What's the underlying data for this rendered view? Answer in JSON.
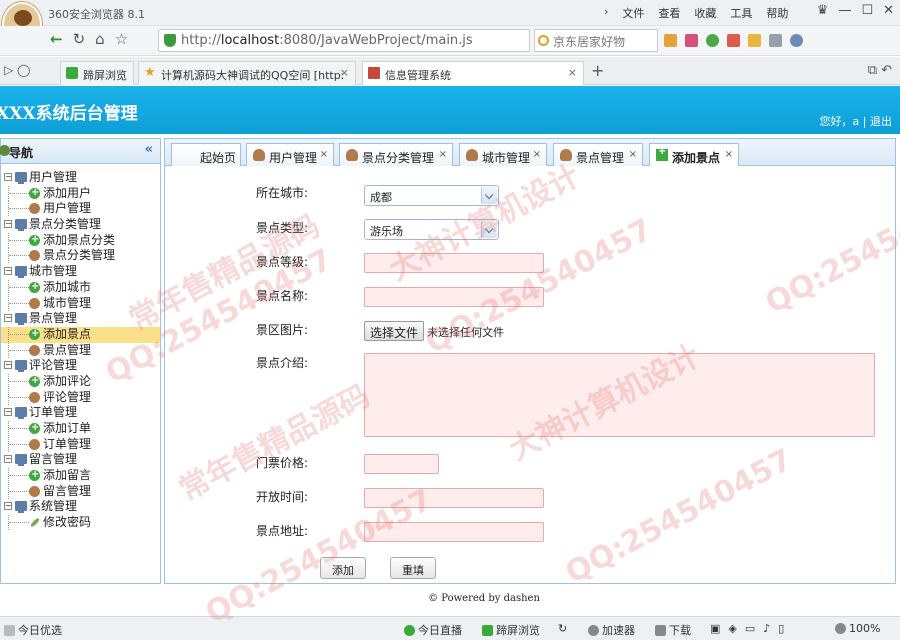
{
  "browser": {
    "title": "360安全浏览器 8.1",
    "menus": [
      "文件",
      "查看",
      "收藏",
      "工具",
      "帮助"
    ],
    "url_prefix": "http://",
    "url_host": "localhost",
    "url_rest": ":8080/JavaWebProject/main.js",
    "search_text": "京东居家好物",
    "tabs": [
      {
        "label": "蹄屏浏览"
      },
      {
        "label": "计算机源码大神调试的QQ空间 [http:"
      },
      {
        "label": "信息管理系统"
      }
    ],
    "new_tab": "+"
  },
  "app": {
    "title": "XXX系统后台管理",
    "greeting": "您好，a",
    "logout": "退出"
  },
  "sidebar": {
    "title": "导航",
    "groups": [
      {
        "label": "用户管理",
        "children": [
          {
            "label": "添加用户",
            "icon": "add-icon"
          },
          {
            "label": "用户管理",
            "icon": "user-icon"
          }
        ]
      },
      {
        "label": "景点分类管理",
        "children": [
          {
            "label": "添加景点分类",
            "icon": "add-icon"
          },
          {
            "label": "景点分类管理",
            "icon": "user-icon"
          }
        ]
      },
      {
        "label": "城市管理",
        "children": [
          {
            "label": "添加城市",
            "icon": "add-icon"
          },
          {
            "label": "城市管理",
            "icon": "user-icon"
          }
        ]
      },
      {
        "label": "景点管理",
        "children": [
          {
            "label": "添加景点",
            "icon": "add-icon"
          },
          {
            "label": "景点管理",
            "icon": "user-icon"
          }
        ]
      },
      {
        "label": "评论管理",
        "children": [
          {
            "label": "添加评论",
            "icon": "add-icon"
          },
          {
            "label": "评论管理",
            "icon": "user-icon"
          }
        ]
      },
      {
        "label": "订单管理",
        "children": [
          {
            "label": "添加订单",
            "icon": "add-icon"
          },
          {
            "label": "订单管理",
            "icon": "user-icon"
          }
        ]
      },
      {
        "label": "留言管理",
        "children": [
          {
            "label": "添加留言",
            "icon": "add-icon"
          },
          {
            "label": "留言管理",
            "icon": "user-icon"
          }
        ]
      },
      {
        "label": "系统管理",
        "children": [
          {
            "label": "修改密码",
            "icon": "pencil-icon"
          }
        ]
      }
    ],
    "selected": "添加景点"
  },
  "tabs": [
    {
      "label": "起始页"
    },
    {
      "label": "用户管理"
    },
    {
      "label": "景点分类管理"
    },
    {
      "label": "城市管理"
    },
    {
      "label": "景点管理"
    },
    {
      "label": "添加景点"
    }
  ],
  "form": {
    "city_label": "所在城市:",
    "city_value": "成都",
    "type_label": "景点类型:",
    "type_value": "游乐场",
    "level_label": "景点等级:",
    "name_label": "景点名称:",
    "image_label": "景区图片:",
    "file_button": "选择文件",
    "file_status": "未选择任何文件",
    "intro_label": "景点介绍:",
    "price_label": "门票价格:",
    "open_label": "开放时间:",
    "address_label": "景点地址:",
    "add_button": "添加",
    "reset_button": "重填"
  },
  "footer": "© Powered by dashen",
  "statusbar": {
    "left": "今日优选",
    "items": [
      "今日直播",
      "蹄屏浏览",
      "加速器",
      "下载"
    ],
    "zoom": "100%"
  },
  "watermark": {
    "qq": "QQ:254540457",
    "cn1": "大神计算机设计",
    "cn2": "常年售精品源码"
  },
  "colors": {
    "header_blue": "#0ea7dd",
    "tab_border": "#9cc3e6",
    "input_pink": "#ffecec",
    "selected_yellow": "#fbe08a"
  }
}
